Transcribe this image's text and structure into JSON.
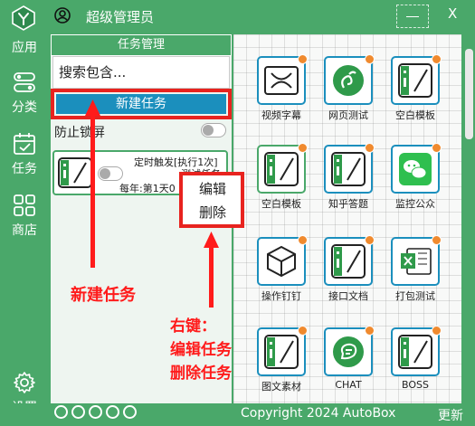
{
  "header": {
    "username": "超级管理员",
    "close_label": "X"
  },
  "sidebar": {
    "items": [
      {
        "label": "应用",
        "icon": "app-logo-icon"
      },
      {
        "label": "分类",
        "icon": "category-icon"
      },
      {
        "label": "任务",
        "icon": "calendar-check-icon"
      },
      {
        "label": "商店",
        "icon": "grid-store-icon"
      }
    ],
    "settings_label": "设置"
  },
  "task_panel": {
    "title": "任务管理",
    "search_placeholder": "搜索包含...",
    "new_task_label": "新建任务",
    "prevent_label": "防止锁屏",
    "card": {
      "trigger": "定时触发[执行1次]",
      "name": "测试任务",
      "schedule": "每年:第1天0"
    }
  },
  "context_menu": {
    "edit": "编辑",
    "delete": "删除"
  },
  "tiles": [
    {
      "label": "视频字幕",
      "icon": "video-subtitle-icon",
      "dot": true
    },
    {
      "label": "网页测试",
      "icon": "web-test-icon",
      "dot": true
    },
    {
      "label": "空白模板",
      "icon": "blank-template-icon",
      "dot": true
    },
    {
      "label": "空白模板",
      "icon": "blank-template-icon",
      "dot": true
    },
    {
      "label": "知乎答题",
      "icon": "blank-template-icon",
      "dot": true
    },
    {
      "label": "监控公众",
      "icon": "wechat-icon",
      "dot": true
    },
    {
      "label": "操作钉钉",
      "icon": "cube-icon",
      "dot": true
    },
    {
      "label": "接口文档",
      "icon": "blank-template-icon",
      "dot": true
    },
    {
      "label": "打包测试",
      "icon": "excel-icon",
      "dot": true
    },
    {
      "label": "图文素材",
      "icon": "blank-template-icon",
      "dot": true
    },
    {
      "label": "CHAT",
      "icon": "chat-icon",
      "dot": true
    },
    {
      "label": "BOSS",
      "icon": "blank-template-icon",
      "dot": true
    }
  ],
  "annotations": {
    "new_task": "新建任务",
    "right_click_title": "右键：",
    "edit_task": "编辑任务",
    "delete_task": "删除任务"
  },
  "footer": {
    "copyright": "Copyright  2024  AutoBox",
    "update": "更新"
  },
  "colors": {
    "brand_green": "#4aa86a",
    "button_blue": "#1b8fbd",
    "annotation_red": "#ff1b1b",
    "badge_orange": "#f08a2e"
  }
}
